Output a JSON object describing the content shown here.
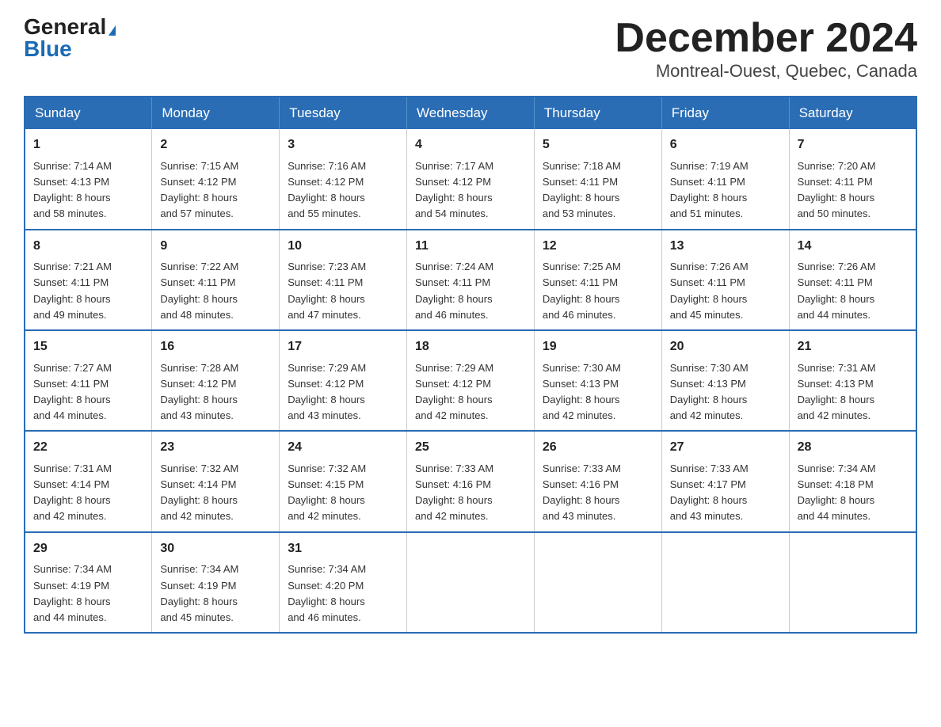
{
  "logo": {
    "general": "General",
    "arrow": "▶",
    "blue": "Blue"
  },
  "header": {
    "month": "December 2024",
    "location": "Montreal-Ouest, Quebec, Canada"
  },
  "weekdays": [
    "Sunday",
    "Monday",
    "Tuesday",
    "Wednesday",
    "Thursday",
    "Friday",
    "Saturday"
  ],
  "weeks": [
    [
      {
        "day": "1",
        "sunrise": "7:14 AM",
        "sunset": "4:13 PM",
        "daylight": "8 hours and 58 minutes."
      },
      {
        "day": "2",
        "sunrise": "7:15 AM",
        "sunset": "4:12 PM",
        "daylight": "8 hours and 57 minutes."
      },
      {
        "day": "3",
        "sunrise": "7:16 AM",
        "sunset": "4:12 PM",
        "daylight": "8 hours and 55 minutes."
      },
      {
        "day": "4",
        "sunrise": "7:17 AM",
        "sunset": "4:12 PM",
        "daylight": "8 hours and 54 minutes."
      },
      {
        "day": "5",
        "sunrise": "7:18 AM",
        "sunset": "4:11 PM",
        "daylight": "8 hours and 53 minutes."
      },
      {
        "day": "6",
        "sunrise": "7:19 AM",
        "sunset": "4:11 PM",
        "daylight": "8 hours and 51 minutes."
      },
      {
        "day": "7",
        "sunrise": "7:20 AM",
        "sunset": "4:11 PM",
        "daylight": "8 hours and 50 minutes."
      }
    ],
    [
      {
        "day": "8",
        "sunrise": "7:21 AM",
        "sunset": "4:11 PM",
        "daylight": "8 hours and 49 minutes."
      },
      {
        "day": "9",
        "sunrise": "7:22 AM",
        "sunset": "4:11 PM",
        "daylight": "8 hours and 48 minutes."
      },
      {
        "day": "10",
        "sunrise": "7:23 AM",
        "sunset": "4:11 PM",
        "daylight": "8 hours and 47 minutes."
      },
      {
        "day": "11",
        "sunrise": "7:24 AM",
        "sunset": "4:11 PM",
        "daylight": "8 hours and 46 minutes."
      },
      {
        "day": "12",
        "sunrise": "7:25 AM",
        "sunset": "4:11 PM",
        "daylight": "8 hours and 46 minutes."
      },
      {
        "day": "13",
        "sunrise": "7:26 AM",
        "sunset": "4:11 PM",
        "daylight": "8 hours and 45 minutes."
      },
      {
        "day": "14",
        "sunrise": "7:26 AM",
        "sunset": "4:11 PM",
        "daylight": "8 hours and 44 minutes."
      }
    ],
    [
      {
        "day": "15",
        "sunrise": "7:27 AM",
        "sunset": "4:11 PM",
        "daylight": "8 hours and 44 minutes."
      },
      {
        "day": "16",
        "sunrise": "7:28 AM",
        "sunset": "4:12 PM",
        "daylight": "8 hours and 43 minutes."
      },
      {
        "day": "17",
        "sunrise": "7:29 AM",
        "sunset": "4:12 PM",
        "daylight": "8 hours and 43 minutes."
      },
      {
        "day": "18",
        "sunrise": "7:29 AM",
        "sunset": "4:12 PM",
        "daylight": "8 hours and 42 minutes."
      },
      {
        "day": "19",
        "sunrise": "7:30 AM",
        "sunset": "4:13 PM",
        "daylight": "8 hours and 42 minutes."
      },
      {
        "day": "20",
        "sunrise": "7:30 AM",
        "sunset": "4:13 PM",
        "daylight": "8 hours and 42 minutes."
      },
      {
        "day": "21",
        "sunrise": "7:31 AM",
        "sunset": "4:13 PM",
        "daylight": "8 hours and 42 minutes."
      }
    ],
    [
      {
        "day": "22",
        "sunrise": "7:31 AM",
        "sunset": "4:14 PM",
        "daylight": "8 hours and 42 minutes."
      },
      {
        "day": "23",
        "sunrise": "7:32 AM",
        "sunset": "4:14 PM",
        "daylight": "8 hours and 42 minutes."
      },
      {
        "day": "24",
        "sunrise": "7:32 AM",
        "sunset": "4:15 PM",
        "daylight": "8 hours and 42 minutes."
      },
      {
        "day": "25",
        "sunrise": "7:33 AM",
        "sunset": "4:16 PM",
        "daylight": "8 hours and 42 minutes."
      },
      {
        "day": "26",
        "sunrise": "7:33 AM",
        "sunset": "4:16 PM",
        "daylight": "8 hours and 43 minutes."
      },
      {
        "day": "27",
        "sunrise": "7:33 AM",
        "sunset": "4:17 PM",
        "daylight": "8 hours and 43 minutes."
      },
      {
        "day": "28",
        "sunrise": "7:34 AM",
        "sunset": "4:18 PM",
        "daylight": "8 hours and 44 minutes."
      }
    ],
    [
      {
        "day": "29",
        "sunrise": "7:34 AM",
        "sunset": "4:19 PM",
        "daylight": "8 hours and 44 minutes."
      },
      {
        "day": "30",
        "sunrise": "7:34 AM",
        "sunset": "4:19 PM",
        "daylight": "8 hours and 45 minutes."
      },
      {
        "day": "31",
        "sunrise": "7:34 AM",
        "sunset": "4:20 PM",
        "daylight": "8 hours and 46 minutes."
      },
      null,
      null,
      null,
      null
    ]
  ],
  "labels": {
    "sunrise": "Sunrise:",
    "sunset": "Sunset:",
    "daylight": "Daylight:"
  }
}
